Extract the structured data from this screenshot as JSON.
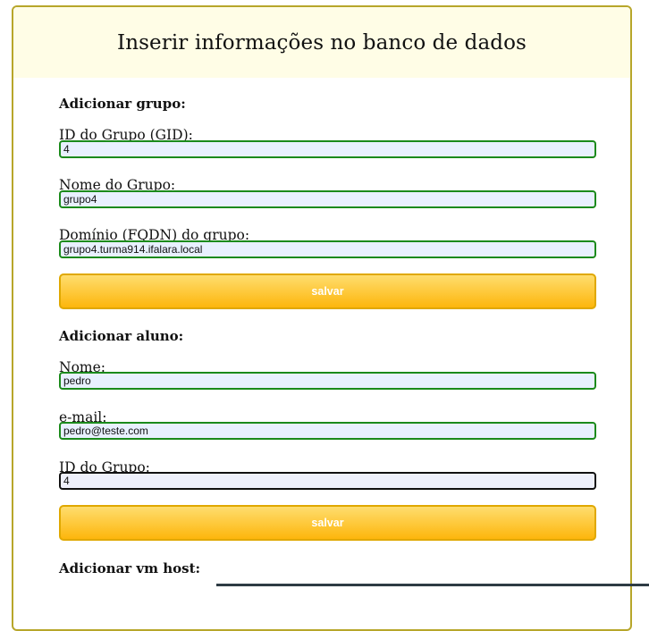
{
  "page_title": "Inserir informações no banco de dados",
  "group_form": {
    "title": "Adicionar grupo:",
    "gid_label": "ID do Grupo (GID):",
    "gid_value": "4",
    "name_label": "Nome do Grupo:",
    "name_value": "grupo4",
    "fqdn_label": "Domínio (FQDN) do grupo:",
    "fqdn_value": "grupo4.turma914.ifalara.local",
    "save_label": "salvar"
  },
  "student_form": {
    "title": "Adicionar aluno:",
    "name_label": "Nome:",
    "name_value": "pedro",
    "email_label": "e-mail:",
    "email_value": "pedro@teste.com",
    "group_id_label": "ID do Grupo:",
    "group_id_value": "4",
    "save_label": "salvar"
  },
  "vm_host_form": {
    "title": "Adicionar vm host:"
  },
  "colors": {
    "header_bg": "#fffde6",
    "panel_border": "#b7a62a",
    "input_border": "#1b8a1b",
    "input_bg": "#e8f0fe",
    "button_top": "#fedd6e",
    "button_bottom": "#fdb60c"
  }
}
